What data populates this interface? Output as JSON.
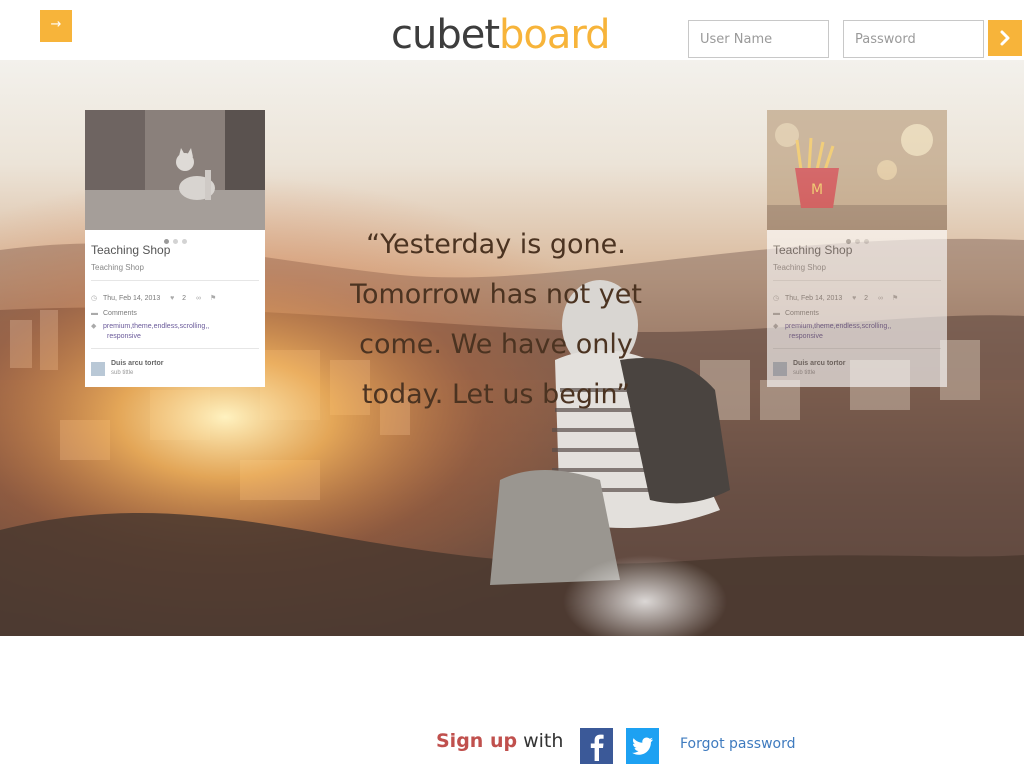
{
  "header": {
    "menu_glyph": "→",
    "logo": {
      "dark": "cubet",
      "accent": "board"
    },
    "login": {
      "username_placeholder": "User Name",
      "password_placeholder": "Password"
    }
  },
  "hero": {
    "quote_lines": [
      "“Yesterday is gone.",
      "Tomorrow has not yet",
      "come. We have only",
      "today. Let us begin”"
    ],
    "cards": [
      {
        "title": "Teaching Shop",
        "subtitle": "Teaching Shop",
        "date": "Thu, Feb 14, 2013",
        "likes": "2",
        "comments": "Comments",
        "tags": "premium,theme,endless,scrolling,,",
        "tags2": "responsive",
        "author": "Duis arcu tortor",
        "author_sub": "sub tittle"
      },
      {
        "title": "Teaching Shop",
        "subtitle": "Teaching Shop",
        "date": "Thu, Feb 14, 2013",
        "likes": "2",
        "comments": "Comments",
        "tags": "premium,theme,endless,scrolling,,",
        "tags2": "responsive",
        "author": "Duis arcu tortor",
        "author_sub": "sub tittle"
      }
    ]
  },
  "footer": {
    "signup_strong": "Sign up",
    "signup_with": " with",
    "forgot": "Forgot password"
  },
  "colors": {
    "accent": "#f7b43a",
    "signup_red": "#c0504d",
    "link_blue": "#3f7bbf",
    "facebook": "#3b5998",
    "twitter": "#1da1f2"
  },
  "icons": [
    "arrow-right-icon",
    "chevron-right-icon",
    "clock-icon",
    "heart-icon",
    "link-icon",
    "flag-icon",
    "comment-icon",
    "tag-icon",
    "facebook-icon",
    "twitter-icon"
  ]
}
